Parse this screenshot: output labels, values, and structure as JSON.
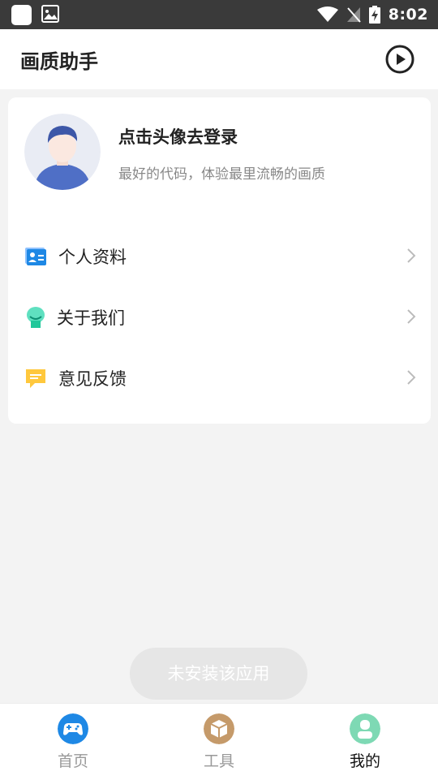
{
  "status_bar": {
    "time": "8:02"
  },
  "header": {
    "title": "画质助手"
  },
  "profile": {
    "login_title": "点击头像去登录",
    "login_subtitle": "最好的代码，体验最里流畅的画质"
  },
  "menu": [
    {
      "label": "个人资料",
      "icon": "id-card-icon"
    },
    {
      "label": "关于我们",
      "icon": "mascot-icon"
    },
    {
      "label": "意见反馈",
      "icon": "feedback-icon"
    }
  ],
  "toast": {
    "text": "未安装该应用"
  },
  "tabs": [
    {
      "label": "首页",
      "icon": "gamepad-icon",
      "color": "#1e88e5"
    },
    {
      "label": "工具",
      "icon": "box-icon",
      "color": "#c59a6a"
    },
    {
      "label": "我的",
      "icon": "user-icon",
      "color": "#7ed9b4",
      "active": true
    }
  ],
  "colors": {
    "background": "#f3f3f3",
    "status_bar": "#3a3a3a"
  }
}
